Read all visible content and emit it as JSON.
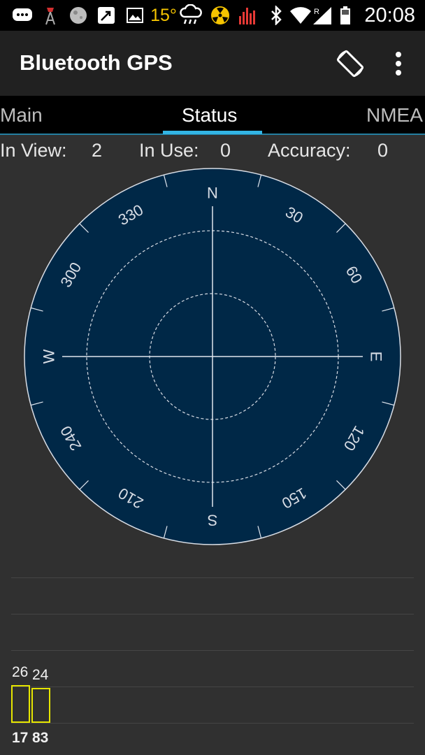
{
  "status_bar": {
    "temperature": "15°",
    "time": "20:08",
    "network_type": "R",
    "icons": [
      "chat-notification-icon",
      "weather-station-icon",
      "moon-icon",
      "call-forward-icon",
      "image-icon",
      "temperature-text",
      "rain-cloud-icon",
      "radiation-icon",
      "signal-meter-icon",
      "bluetooth-icon",
      "wifi-icon",
      "cell-signal-icon",
      "battery-icon"
    ]
  },
  "action_bar": {
    "title": "Bluetooth GPS",
    "actions": [
      "screen-rotation-icon",
      "overflow-menu-icon"
    ]
  },
  "tabs": [
    {
      "label": "Main",
      "active": false
    },
    {
      "label": "Status",
      "active": true
    },
    {
      "label": "NMEA",
      "active": false
    }
  ],
  "stats": {
    "in_view_label": "In View:",
    "in_view_value": "2",
    "in_use_label": "In Use:",
    "in_use_value": "0",
    "accuracy_label": "Accuracy:",
    "accuracy_value": "0"
  },
  "sky_plot": {
    "cardinals": {
      "north": "N",
      "east": "E",
      "south": "S",
      "west": "W"
    },
    "degree_labels": [
      "30",
      "60",
      "120",
      "150",
      "210",
      "240",
      "300",
      "330"
    ],
    "colors": {
      "background": "#002847",
      "lines": "#e0e6ee"
    }
  },
  "satellites": [
    {
      "prn": "17",
      "snr": "26"
    },
    {
      "prn": "83",
      "snr": "24"
    }
  ],
  "colors": {
    "accent": "#33b5e5",
    "bar": "#e6e600"
  }
}
